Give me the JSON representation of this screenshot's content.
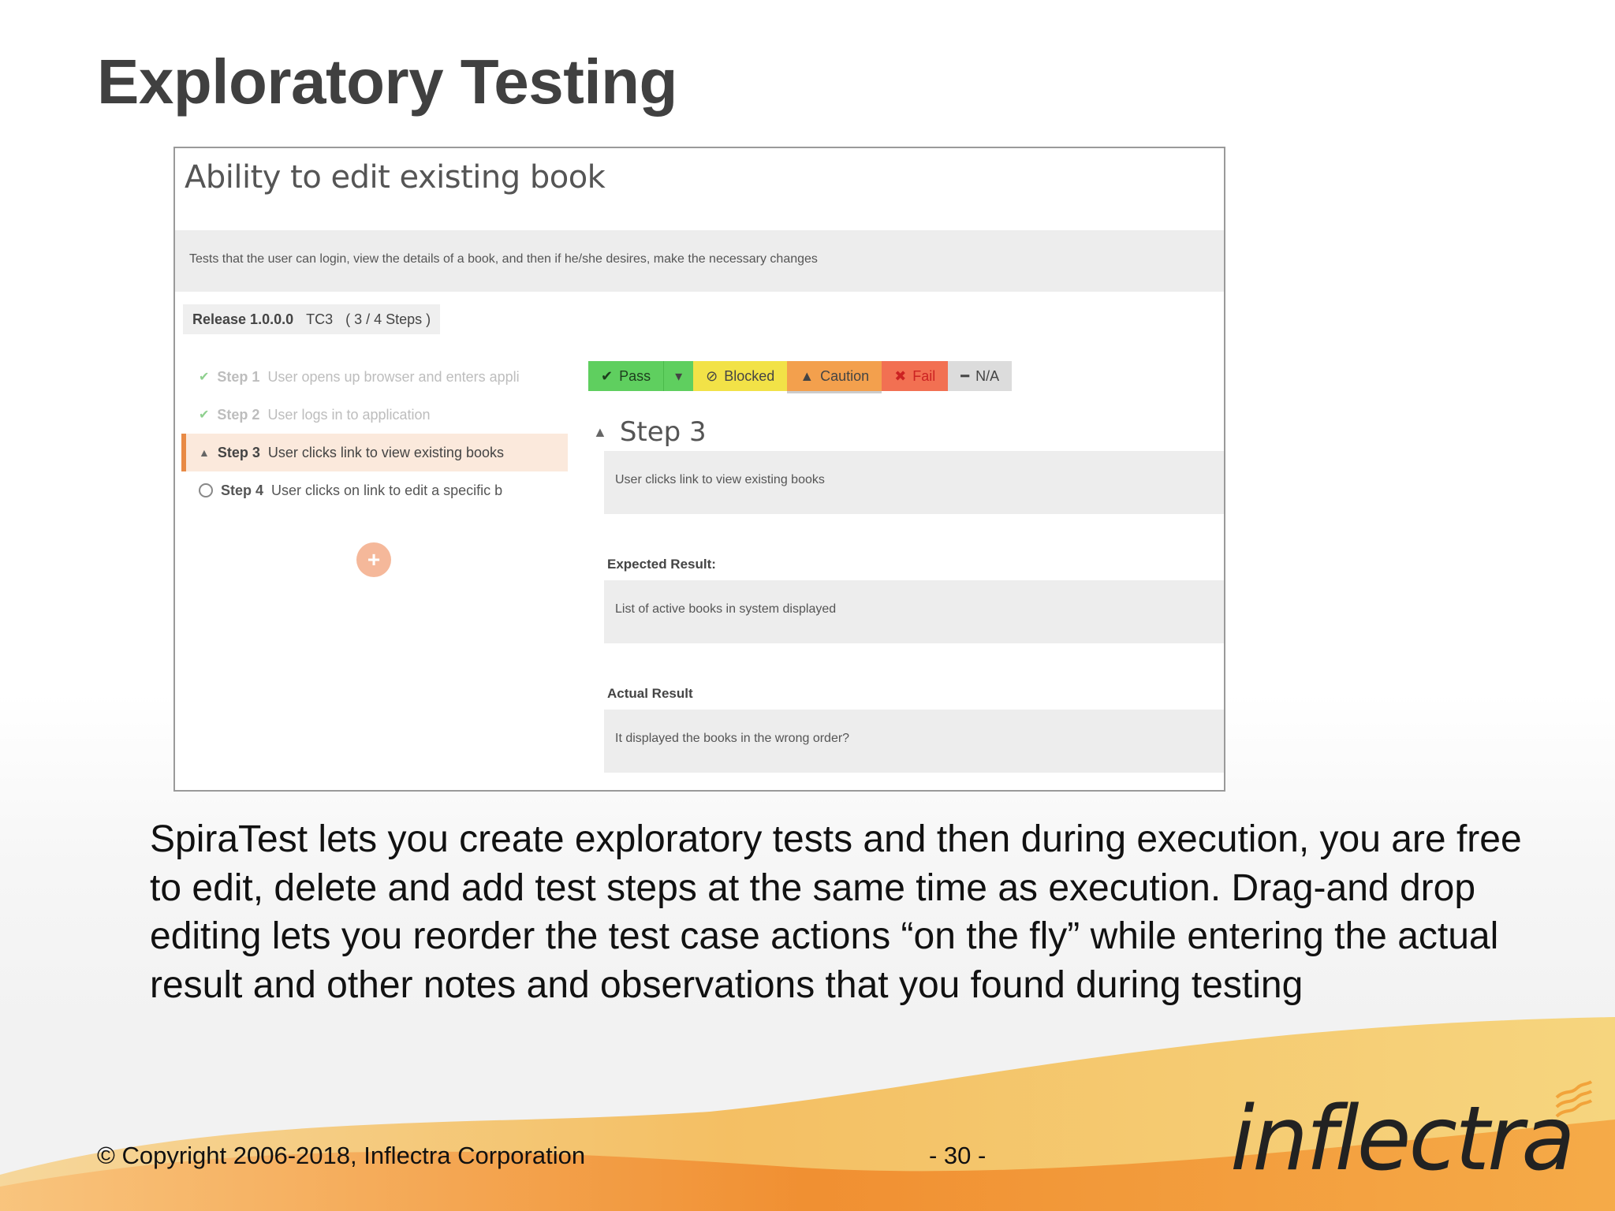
{
  "slide": {
    "title": "Exploratory Testing",
    "body": "SpiraTest lets you create exploratory tests and then during execution, you are free to edit, delete and add test steps at the same time as execution. Drag-and drop editing lets you reorder the test case actions “on the fly” while entering the actual result and other notes and observations that you found during testing",
    "copyright": "© Copyright 2006-2018, Inflectra Corporation",
    "page_number": "- 30 -",
    "logo_text": "inflectra"
  },
  "screenshot": {
    "test_case_title": "Ability to edit existing book",
    "description": "Tests that the user can login, view the details of a book, and then if he/she desires, make the necessary changes",
    "release": "Release 1.0.0.0",
    "test_case_id": "TC3",
    "step_progress": "( 3 / 4 Steps )",
    "steps": [
      {
        "num": "Step 1",
        "text": "User opens up browser and enters appli",
        "state": "done"
      },
      {
        "num": "Step 2",
        "text": "User logs in to application",
        "state": "done"
      },
      {
        "num": "Step 3",
        "text": "User clicks link to view existing books",
        "state": "active"
      },
      {
        "num": "Step 4",
        "text": "User clicks on link to edit a specific b",
        "state": "pending"
      }
    ],
    "status_buttons": {
      "pass": "Pass",
      "blocked": "Blocked",
      "caution": "Caution",
      "fail": "Fail",
      "na": "N/A"
    },
    "current_step": {
      "title": "Step 3",
      "description": "User clicks link to view existing books",
      "expected_label": "Expected Result:",
      "expected_value": "List of active books in system displayed",
      "actual_label": "Actual Result",
      "actual_value": "It displayed the books in the wrong order?"
    }
  },
  "colors": {
    "pass": "#5fcf5f",
    "blocked": "#f2e247",
    "caution": "#f3a04d",
    "fail": "#f27052",
    "active_step": "#e88a45",
    "wave_orange": "#f29a3c",
    "wave_yellow": "#f6c85a"
  }
}
